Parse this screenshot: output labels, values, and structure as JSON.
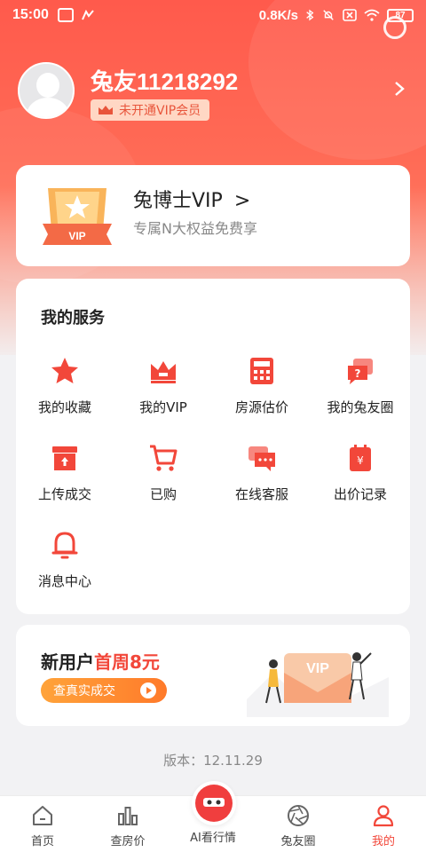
{
  "status_bar": {
    "time": "15:00",
    "speed": "0.8K/s",
    "battery": "87"
  },
  "profile": {
    "username": "兔友11218292",
    "vip_status": "未开通VIP会员"
  },
  "vip_card": {
    "title": "兔博士VIP",
    "chevron": ">",
    "subtitle": "专属N大权益免费享",
    "emblem_text": "VIP"
  },
  "services": {
    "title": "我的服务",
    "items": [
      {
        "label": "我的收藏",
        "icon": "star-icon"
      },
      {
        "label": "我的VIP",
        "icon": "crown-icon"
      },
      {
        "label": "房源估价",
        "icon": "calculator-icon"
      },
      {
        "label": "我的兔友圈",
        "icon": "chat-question-icon"
      },
      {
        "label": "上传成交",
        "icon": "upload-box-icon"
      },
      {
        "label": "已购",
        "icon": "cart-icon"
      },
      {
        "label": "在线客服",
        "icon": "chat-bubbles-icon"
      },
      {
        "label": "出价记录",
        "icon": "price-calendar-icon"
      },
      {
        "label": "消息中心",
        "icon": "bell-icon"
      }
    ]
  },
  "promo": {
    "title_prefix": "新用户",
    "title_highlight": "首周8元",
    "button_label": "查真实成交",
    "illustration_text": "VIP"
  },
  "version": "版本：12.11.29",
  "bottom_nav": {
    "items": [
      {
        "label": "首页",
        "icon": "home-icon",
        "active": false
      },
      {
        "label": "查房价",
        "icon": "bar-chart-icon",
        "active": false
      },
      {
        "label": "AI看行情",
        "icon": "ai-robot-icon",
        "active": false
      },
      {
        "label": "兔友圈",
        "icon": "aperture-icon",
        "active": false
      },
      {
        "label": "我的",
        "icon": "person-icon",
        "active": true
      }
    ]
  },
  "colors": {
    "brand_red": "#f2473a",
    "hero_top": "#ff5a4c",
    "promo_orange": "#ff7a2a"
  }
}
